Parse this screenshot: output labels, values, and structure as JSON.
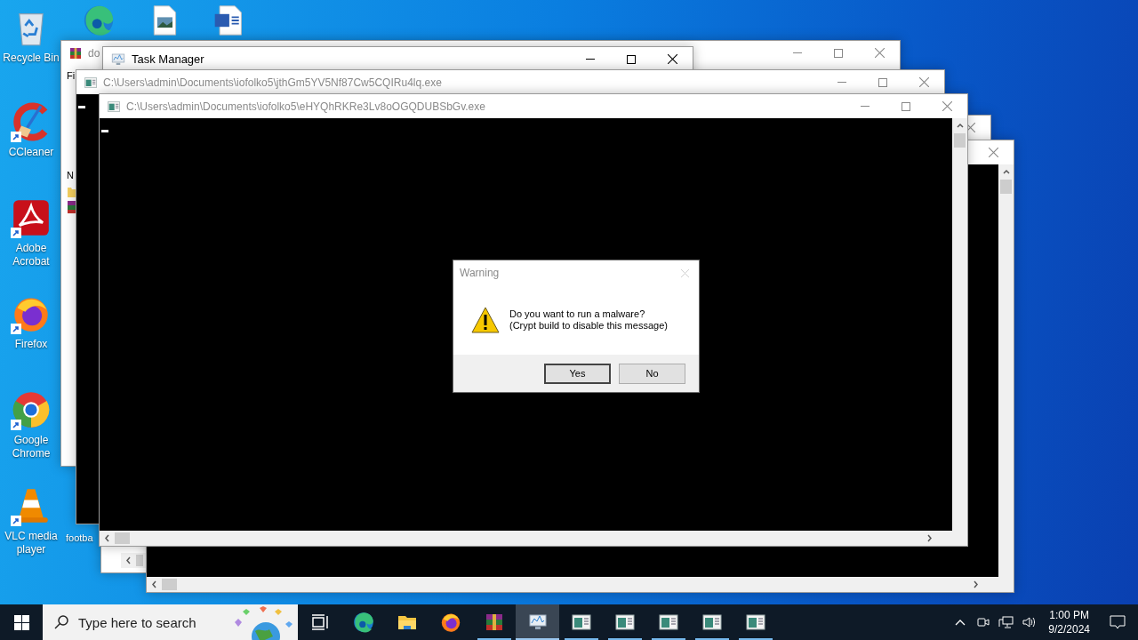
{
  "desktop_icons": [
    {
      "kind": "recycle-bin",
      "label": "Recycle Bin"
    },
    {
      "kind": "ccleaner",
      "label": "CCleaner",
      "shortcut": true
    },
    {
      "kind": "acrobat",
      "label": "Adobe Acrobat",
      "shortcut": true
    },
    {
      "kind": "firefox",
      "label": "Firefox",
      "shortcut": true
    },
    {
      "kind": "chrome",
      "label": "Google Chrome",
      "shortcut": true
    },
    {
      "kind": "vlc",
      "label": "VLC media player",
      "shortcut": true
    },
    {
      "kind": "edge"
    },
    {
      "kind": "image-file"
    },
    {
      "kind": "word-doc"
    },
    {
      "kind": "hidden",
      "label": "footba"
    }
  ],
  "windows": [
    {
      "kind": "archiver",
      "title": "do",
      "active": false,
      "menu": "Fi",
      "column": "N"
    },
    {
      "kind": "task-manager",
      "title": "Task Manager",
      "active": true
    },
    {
      "kind": "blank"
    },
    {
      "kind": "console"
    },
    {
      "kind": "console",
      "title": "C:\\Users\\admin\\Documents\\iofolko5\\jthGm5YV5Nf87Cw5CQIRu4lq.exe",
      "active": false
    },
    {
      "kind": "console",
      "title": "C:\\Users\\admin\\Documents\\iofolko5\\eHYQhRKRe3Lv8oOGQDUBSbGv.exe",
      "active": false
    }
  ],
  "dialog": {
    "title": "Warning",
    "message": [
      "Do you want to run a malware?",
      "(Crypt build to disable this message)"
    ],
    "buttons": [
      {
        "label": "Yes",
        "default": true
      },
      {
        "label": "No",
        "default": false
      }
    ]
  },
  "taskbar": {
    "search": {
      "placeholder": "Type here to search"
    },
    "apps": [
      {
        "kind": "task-view",
        "running": false,
        "selected": false
      },
      {
        "kind": "edge",
        "running": false,
        "selected": false
      },
      {
        "kind": "folder",
        "running": false,
        "selected": false
      },
      {
        "kind": "firefox",
        "running": false,
        "selected": false
      },
      {
        "kind": "winrar",
        "running": true,
        "selected": false
      },
      {
        "kind": "task-manager",
        "running": true,
        "selected": true
      },
      {
        "kind": "console",
        "running": true,
        "selected": false
      },
      {
        "kind": "console",
        "running": true,
        "selected": false
      },
      {
        "kind": "console",
        "running": true,
        "selected": false
      },
      {
        "kind": "console",
        "running": true,
        "selected": false
      },
      {
        "kind": "console",
        "running": true,
        "selected": false
      }
    ],
    "clock": {
      "time": "1:00 PM",
      "date": "9/2/2024"
    }
  }
}
